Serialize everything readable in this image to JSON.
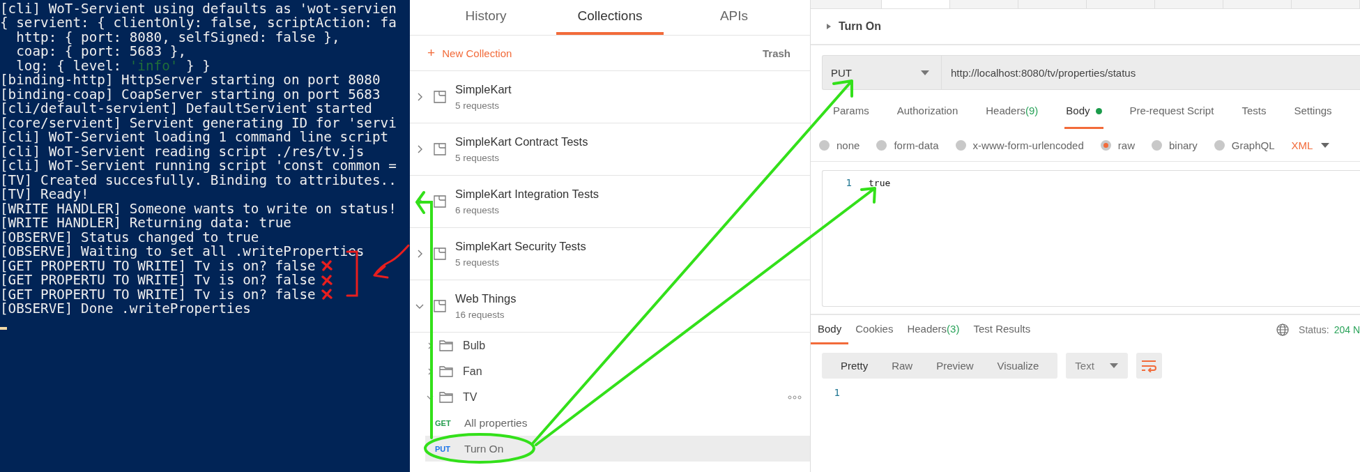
{
  "terminal": {
    "lines": [
      {
        "parts": [
          {
            "text": "[cli] WoT-Servient using defaults as 'wot-servien",
            "kind": "plain"
          }
        ],
        "flagged": false
      },
      {
        "parts": [
          {
            "text": "{ servient: { clientOnly: false, scriptAction: fa",
            "kind": "plain"
          }
        ],
        "flagged": false
      },
      {
        "parts": [
          {
            "text": "  http: { port: 8080, selfSigned: false },",
            "kind": "plain"
          }
        ],
        "flagged": false
      },
      {
        "parts": [
          {
            "text": "  coap: { port: 5683 },",
            "kind": "plain"
          }
        ],
        "flagged": false
      },
      {
        "parts": [
          {
            "text": "  log: { level: ",
            "kind": "plain"
          },
          {
            "text": "'info'",
            "kind": "string"
          },
          {
            "text": " } }",
            "kind": "plain"
          }
        ],
        "flagged": false
      },
      {
        "parts": [
          {
            "text": "[binding-http] HttpServer starting on port 8080",
            "kind": "plain"
          }
        ],
        "flagged": false
      },
      {
        "parts": [
          {
            "text": "[binding-coap] CoapServer starting on port 5683",
            "kind": "plain"
          }
        ],
        "flagged": false
      },
      {
        "parts": [
          {
            "text": "[cli/default-servient] DefaultServient started",
            "kind": "plain"
          }
        ],
        "flagged": false
      },
      {
        "parts": [
          {
            "text": "[core/servient] Servient generating ID for 'servi",
            "kind": "plain"
          }
        ],
        "flagged": false
      },
      {
        "parts": [
          {
            "text": "[cli] WoT-Servient loading 1 command line script",
            "kind": "plain"
          }
        ],
        "flagged": false
      },
      {
        "parts": [
          {
            "text": "[cli] WoT-Servient reading script ./res/tv.js",
            "kind": "plain"
          }
        ],
        "flagged": false
      },
      {
        "parts": [
          {
            "text": "[cli] WoT-Servient running script 'const common =",
            "kind": "plain"
          }
        ],
        "flagged": false
      },
      {
        "parts": [
          {
            "text": "[TV] Created succesfully. Binding to attributes..",
            "kind": "plain"
          }
        ],
        "flagged": false
      },
      {
        "parts": [
          {
            "text": "[TV] Ready!",
            "kind": "plain"
          }
        ],
        "flagged": false
      },
      {
        "parts": [
          {
            "text": "[WRITE HANDLER] Someone wants to write on status!",
            "kind": "plain"
          }
        ],
        "flagged": false
      },
      {
        "parts": [
          {
            "text": "[WRITE HANDLER] Returning data: true",
            "kind": "plain"
          }
        ],
        "flagged": false
      },
      {
        "parts": [
          {
            "text": "[OBSERVE] Status changed to true",
            "kind": "plain"
          }
        ],
        "flagged": false
      },
      {
        "parts": [
          {
            "text": "[OBSERVE] Waiting to set all .writeProperties",
            "kind": "plain"
          }
        ],
        "flagged": false
      },
      {
        "parts": [
          {
            "text": "[GET PROPERTU TO WRITE] Tv is on? false",
            "kind": "plain"
          }
        ],
        "flagged": true
      },
      {
        "parts": [
          {
            "text": "[GET PROPERTU TO WRITE] Tv is on? false",
            "kind": "plain"
          }
        ],
        "flagged": true
      },
      {
        "parts": [
          {
            "text": "[GET PROPERTU TO WRITE] Tv is on? false",
            "kind": "plain"
          }
        ],
        "flagged": true
      },
      {
        "parts": [
          {
            "text": "[OBSERVE] Done .writeProperties",
            "kind": "plain"
          }
        ],
        "flagged": false
      }
    ]
  },
  "sidebar": {
    "tabs": [
      {
        "label": "History",
        "selected": false
      },
      {
        "label": "Collections",
        "selected": true
      },
      {
        "label": "APIs",
        "selected": false
      }
    ],
    "new_collection": {
      "icon": "+",
      "label": "New Collection"
    },
    "trash": "Trash",
    "collections": [
      {
        "name": "SimpleKart",
        "count": "5 requests",
        "expanded": false
      },
      {
        "name": "SimpleKart Contract Tests",
        "count": "5 requests",
        "expanded": false
      },
      {
        "name": "SimpleKart Integration Tests",
        "count": "6 requests",
        "expanded": false
      },
      {
        "name": "SimpleKart Security Tests",
        "count": "5 requests",
        "expanded": false
      },
      {
        "name": "Web Things",
        "count": "16 requests",
        "expanded": true,
        "children": [
          {
            "kind": "folder",
            "name": "Bulb",
            "expanded": false
          },
          {
            "kind": "folder",
            "name": "Fan",
            "expanded": false
          },
          {
            "kind": "folder",
            "name": "TV",
            "expanded": true,
            "children": [
              {
                "kind": "request",
                "method": "GET",
                "color": "#249c4e",
                "name": "All properties",
                "selected": false
              },
              {
                "kind": "request",
                "method": "PUT",
                "color": "#1a73e8",
                "name": "Turn On",
                "selected": true
              }
            ]
          }
        ]
      }
    ]
  },
  "request": {
    "name": "Turn On",
    "method": "PUT",
    "url": "http://localhost:8080/tv/properties/status",
    "tabs": [
      {
        "label": "Params",
        "selected": false,
        "indicator": false
      },
      {
        "label": "Authorization",
        "selected": false,
        "indicator": false
      },
      {
        "label": "Headers",
        "count": "(9)",
        "selected": false,
        "indicator": false
      },
      {
        "label": "Body",
        "selected": true,
        "indicator": true
      },
      {
        "label": "Pre-request Script",
        "selected": false,
        "indicator": false
      },
      {
        "label": "Tests",
        "selected": false,
        "indicator": false
      },
      {
        "label": "Settings",
        "selected": false,
        "indicator": false
      }
    ],
    "body_modes": [
      {
        "label": "none",
        "selected": false
      },
      {
        "label": "form-data",
        "selected": false
      },
      {
        "label": "x-www-form-urlencoded",
        "selected": false
      },
      {
        "label": "raw",
        "selected": true
      },
      {
        "label": "binary",
        "selected": false
      },
      {
        "label": "GraphQL",
        "selected": false
      }
    ],
    "format": "XML",
    "editor_lines": [
      {
        "number": "1",
        "text": "true"
      }
    ]
  },
  "response": {
    "tabs": [
      {
        "label": "Body",
        "selected": true
      },
      {
        "label": "Cookies",
        "selected": false
      },
      {
        "label": "Headers",
        "count": "(3)",
        "selected": false
      },
      {
        "label": "Test Results",
        "selected": false
      }
    ],
    "status_label": "Status:",
    "status_value": "204 N",
    "view_modes": [
      {
        "label": "Pretty",
        "selected": true
      },
      {
        "label": "Raw",
        "selected": false
      },
      {
        "label": "Preview",
        "selected": false
      },
      {
        "label": "Visualize",
        "selected": false
      }
    ],
    "type": "Text",
    "lines": [
      {
        "number": "1"
      }
    ]
  }
}
